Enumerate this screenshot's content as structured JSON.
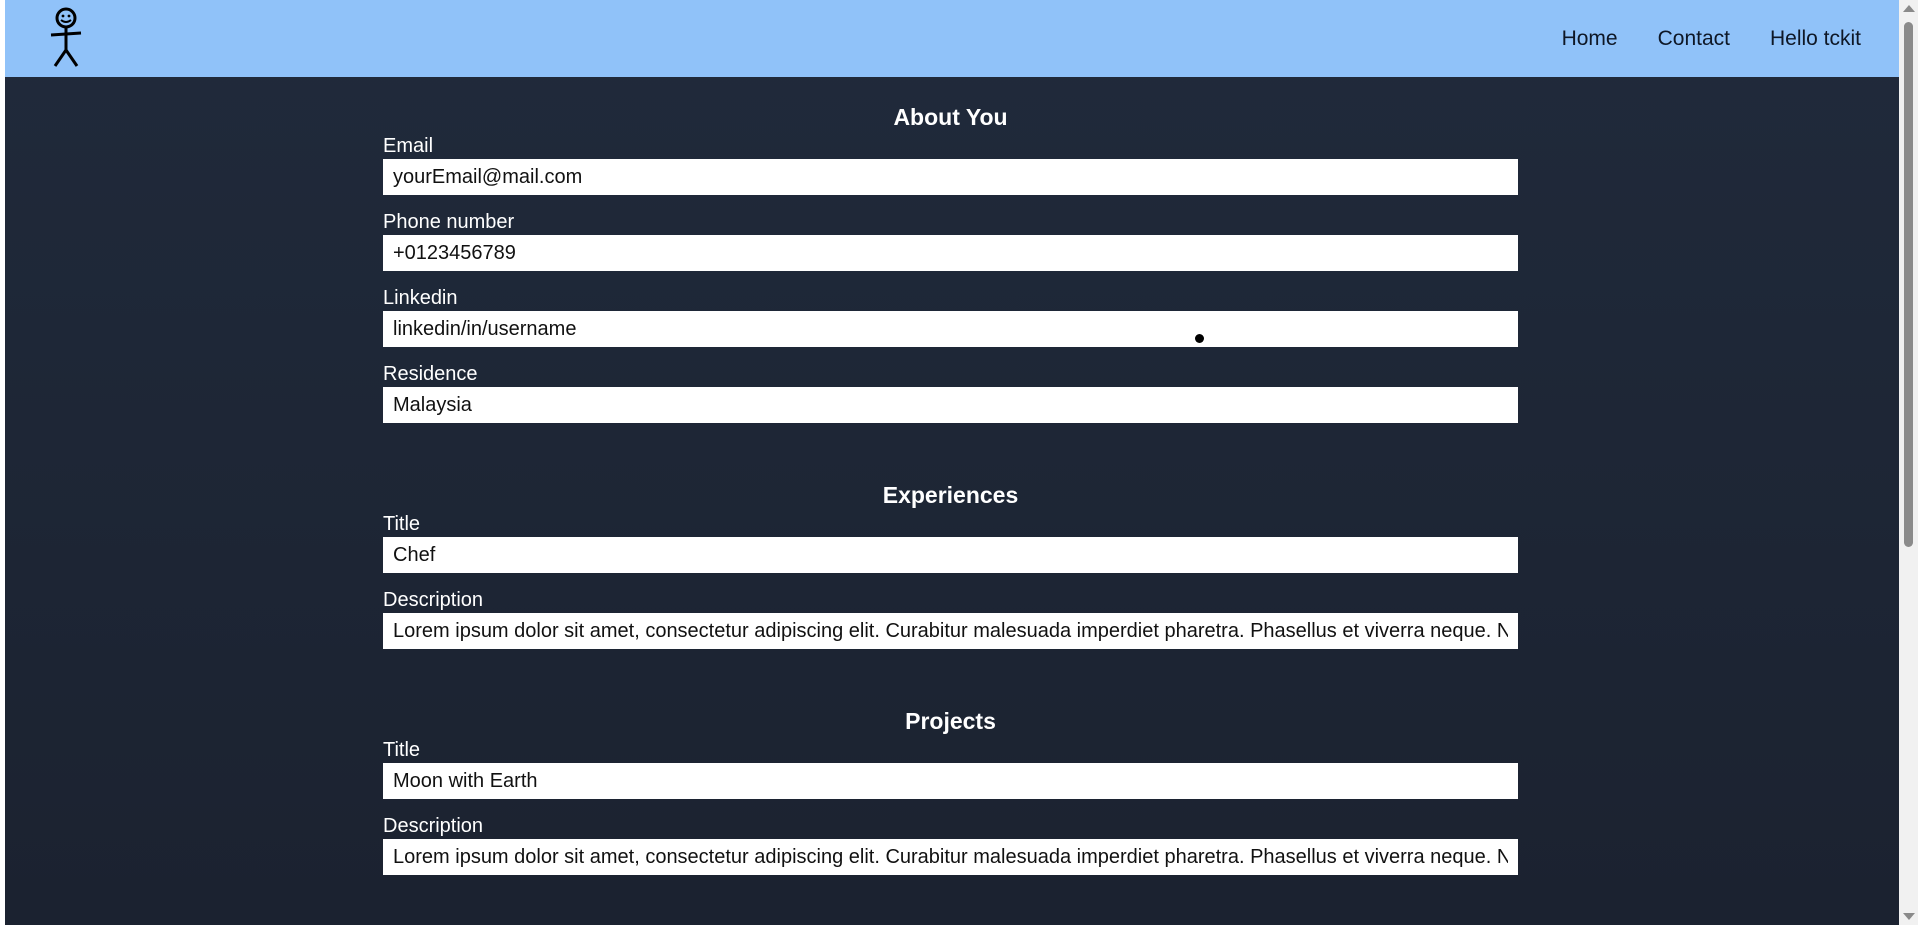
{
  "navbar": {
    "logo_icon": "stick-figure-icon",
    "links": [
      "Home",
      "Contact",
      "Hello tckit"
    ]
  },
  "sections": [
    {
      "heading": "About You",
      "fields": [
        {
          "label": "Email",
          "value": "yourEmail@mail.com"
        },
        {
          "label": "Phone number",
          "value": "+0123456789"
        },
        {
          "label": "Linkedin",
          "value": "linkedin/in/username"
        },
        {
          "label": "Residence",
          "value": "Malaysia"
        }
      ]
    },
    {
      "heading": "Experiences",
      "fields": [
        {
          "label": "Title",
          "value": "Chef"
        },
        {
          "label": "Description",
          "value": "Lorem ipsum dolor sit amet, consectetur adipiscing elit. Curabitur malesuada imperdiet pharetra. Phasellus et viverra neque. Na"
        }
      ]
    },
    {
      "heading": "Projects",
      "fields": [
        {
          "label": "Title",
          "value": "Moon with Earth"
        },
        {
          "label": "Description",
          "value": "Lorem ipsum dolor sit amet, consectetur adipiscing elit. Curabitur malesuada imperdiet pharetra. Phasellus et viverra neque. Na"
        }
      ]
    }
  ],
  "colors": {
    "navbar_bg": "#90c2f9",
    "page_bg": "#1e2636",
    "text_light": "#ffffff"
  }
}
